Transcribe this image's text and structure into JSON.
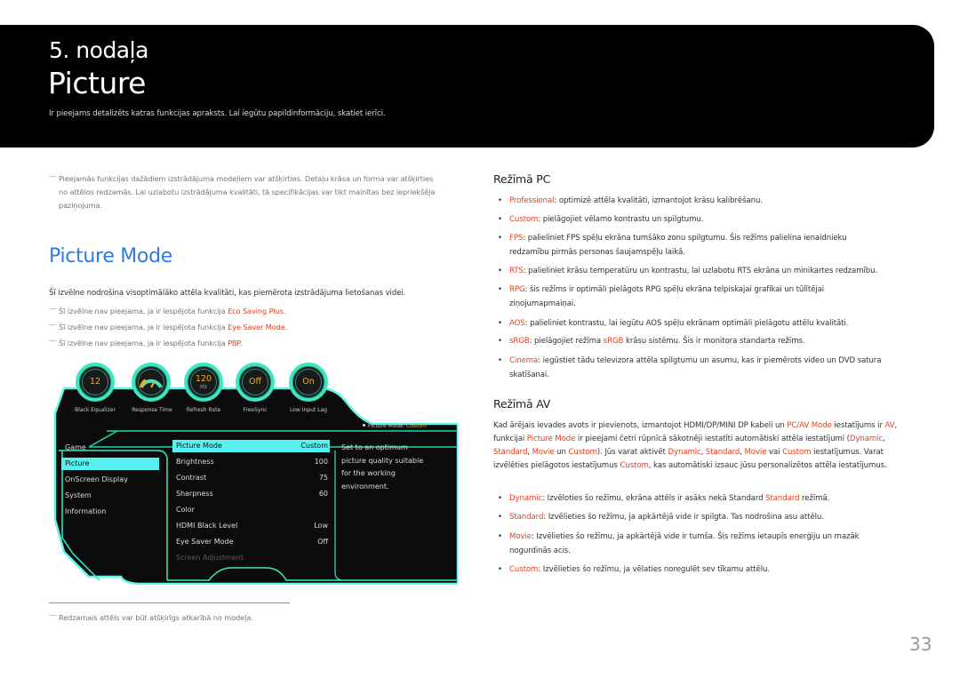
{
  "header": {
    "chapter": "5. nodaļa",
    "title": "Picture",
    "intro": "Ir pieejams detalizēts katras funkcijas apraksts. Lai iegūtu papildinformāciju, skatiet ierīci."
  },
  "left": {
    "note_top": "Pieejamās funkcijas dažādiem izstrādājuma modeļiem var atšķirties. Detaļu krāsa un forma var atšķirties no attēlos redzamās. Lai uzlabotu izstrādājuma kvalitāti, tā specifikācijas var tikt mainītas bez iepriekšēja paziņojuma.",
    "note_top_lines": [
      "Pieejamās funkcijas dažādiem izstrādājuma modeļiem var atšķirties. Detaļu krāsa un forma var atšķirties",
      "no attēlos redzamās. Lai uzlabotu izstrādājuma kvalitāti, tā specifikācijas var tikt mainītas bez iepriekšēja",
      "paziņojuma."
    ],
    "section_title": "Picture Mode",
    "lead": "Šī izvēlne nodrošina visoptimālāko attēla kvalitāti, kas piemērota izstrādājuma lietošanas videi.",
    "notes": [
      {
        "prefix": "Šī izvēlne nav pieejama, ja ir iespējota funkcija ",
        "highlight": "Eco Saving Plus",
        "suffix": "."
      },
      {
        "prefix": "Šī izvēlne nav pieejama, ja ir iespējota funkcija ",
        "highlight": "Eye Saver Mode",
        "suffix": "."
      },
      {
        "prefix": "Šī izvēlne nav pieejama, ja ir iespējota funkcija ",
        "highlight": "PBP",
        "suffix": "."
      }
    ],
    "footnote": "Redzamais attēls var būt atšķirīgs atkarībā no modeļa.",
    "dash": "―"
  },
  "osd": {
    "dials": [
      {
        "value": "12",
        "unit": "",
        "label": "Black Equalizer",
        "icon": ""
      },
      {
        "value": "",
        "unit": "",
        "label": "Response Time",
        "icon": "gauge-icon"
      },
      {
        "value": "120",
        "unit": "Hz",
        "label": "Refresh Rate",
        "icon": ""
      },
      {
        "value": "Off",
        "unit": "",
        "label": "FreeSync",
        "icon": ""
      },
      {
        "value": "On",
        "unit": "",
        "label": "Low Input Lag",
        "icon": ""
      }
    ],
    "status_label": "Picture Mode: ",
    "status_value": "Custom",
    "categories": [
      {
        "label": "Game",
        "selected": false
      },
      {
        "label": "Picture",
        "selected": true
      },
      {
        "label": "OnScreen Display",
        "selected": false
      },
      {
        "label": "System",
        "selected": false
      },
      {
        "label": "Information",
        "selected": false
      }
    ],
    "settings": [
      {
        "label": "Picture Mode",
        "value": "Custom",
        "selected": true
      },
      {
        "label": "Brightness",
        "value": "100"
      },
      {
        "label": "Contrast",
        "value": "75"
      },
      {
        "label": "Sharpness",
        "value": "60"
      },
      {
        "label": "Color",
        "value": ""
      },
      {
        "label": "HDMI Black Level",
        "value": "Low"
      },
      {
        "label": "Eye Saver Mode",
        "value": "Off"
      },
      {
        "label": "Screen Adjustment",
        "value": "",
        "disabled": true
      }
    ],
    "description_lines": [
      "Set to an optimum",
      "picture quality suitable",
      "for the working",
      "environment."
    ],
    "colors": {
      "accent": "#3de6c0",
      "highlight": "#59f0f0",
      "value": "#e9b227"
    }
  },
  "right": {
    "pc_heading": "Režīmā PC",
    "pc_items": [
      {
        "term": "Professional",
        "lines": [
          ": optimizē attēla kvalitāti, izmantojot krāsu kalibrēšanu."
        ]
      },
      {
        "term": "Custom",
        "lines": [
          ": pielāgojiet vēlamo kontrastu un spilgtumu."
        ]
      },
      {
        "term": "FPS",
        "lines": [
          ": palieliniet FPS spēļu ekrāna tumšāko zonu spilgtumu. Šis režīms palielina ienaidnieku",
          "redzamību pirmās personas šaujamspēļu laikā."
        ]
      },
      {
        "term": "RTS",
        "lines": [
          ": palieliniet krāsu temperatūru un kontrastu, lai uzlabotu RTS ekrāna un minikartes redzamību."
        ]
      },
      {
        "term": "RPG",
        "lines": [
          ": šis režīms ir optimāli pielāgots RPG spēļu ekrāna telpiskajai grafikai un tūlītējai",
          "ziņojumapmaiņai."
        ]
      },
      {
        "term": "AOS",
        "lines": [
          ": palieliniet kontrastu, lai iegūtu AOS spēļu ekrānam optimāli pielāgotu attēlu kvalitāti."
        ]
      },
      {
        "term": "sRGB",
        "lines": [
          ": pielāgojiet režīma "
        ],
        "inline_hl": "sRGB",
        "after": " krāsu sistēmu. Šis ir monitora standarta režīms."
      },
      {
        "term": "Cinema",
        "lines": [
          ": iegūstiet tādu televizora attēla spilgtumu un asumu, kas ir piemērots video un DVD satura",
          "skatīšanai."
        ]
      }
    ],
    "av_heading": "Režīmā AV",
    "av_para": [
      {
        "t": "Kad ārējais ievades avots ir pievienots, izmantojot HDMI/DP/MINI DP kabeli un "
      },
      {
        "h": "PC/AV Mode"
      },
      {
        "t": " iestatījums ir "
      },
      {
        "h": "AV"
      },
      {
        "t": ", funkcijai "
      },
      {
        "h": "Picture Mode"
      },
      {
        "t": " ir pieejami četri rūpnīcā sākotnēji iestatīti automātiski attēla iestatījumi ("
      },
      {
        "h": "Dynamic"
      },
      {
        "t": ", "
      },
      {
        "h": "Standard"
      },
      {
        "t": ", "
      },
      {
        "h": "Movie"
      },
      {
        "t": " un "
      },
      {
        "h": "Custom"
      },
      {
        "t": "). Jūs varat aktivēt "
      },
      {
        "h": "Dynamic"
      },
      {
        "t": ", "
      },
      {
        "h": "Standard"
      },
      {
        "t": ", "
      },
      {
        "h": "Movie"
      },
      {
        "t": " vai "
      },
      {
        "h": "Custom"
      },
      {
        "t": " iestatījumus. Varat izvēlēties pielāgotos iestatījumus "
      },
      {
        "h": "Custom"
      },
      {
        "t": ", kas automātiski izsauc jūsu personalizētos attēla iestatījumus."
      }
    ],
    "av_items": [
      {
        "term": "Dynamic",
        "lines": [
          ": Izvēloties šo režīmu, ekrāna attēls ir asāks nekā Standard "
        ],
        "inline_hl": "Standard",
        "after": " režīmā."
      },
      {
        "term": "Standard",
        "lines": [
          ": Izvēlieties šo režīmu, ja apkārtējā vide ir spilgta. Tas nodrošina asu attēlu."
        ]
      },
      {
        "term": "Movie",
        "lines": [
          ": Izvēlieties šo režīmu, ja apkārtējā vide ir tumša. Šis režīms ietaupīs enerģiju un mazāk",
          "nogurdinās acis."
        ]
      },
      {
        "term": "Custom",
        "lines": [
          ": Izvēlieties šo režīmu, ja vēlaties noregulēt sev tīkamu attēlu."
        ]
      }
    ],
    "bullet": "•"
  },
  "page_number": "33",
  "colors": {
    "highlight": "#e2401f",
    "section_title": "#2b7de3",
    "header_bg": "#000000"
  }
}
